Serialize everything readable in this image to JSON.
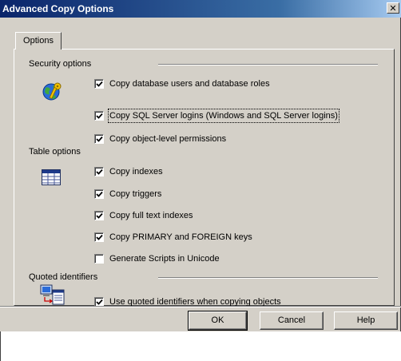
{
  "window": {
    "title": "Advanced Copy Options",
    "close_glyph": "✕"
  },
  "tabs": [
    {
      "label": "Options"
    }
  ],
  "sections": {
    "security": {
      "label": "Security options",
      "icon": "security-globe-key-icon",
      "options": [
        {
          "label": "Copy database users and database roles",
          "checked": true
        },
        {
          "label": "Copy SQL Server logins (Windows and SQL Server logins)",
          "checked": true,
          "focused": true
        },
        {
          "label": "Copy object-level permissions",
          "checked": true
        }
      ]
    },
    "table": {
      "label": "Table options",
      "icon": "table-grid-icon",
      "options": [
        {
          "label": "Copy indexes",
          "checked": true
        },
        {
          "label": "Copy triggers",
          "checked": true
        },
        {
          "label": "Copy full text indexes",
          "checked": true
        },
        {
          "label": "Copy PRIMARY and FOREIGN keys",
          "checked": true
        },
        {
          "label": "Generate Scripts in Unicode",
          "checked": false
        }
      ]
    },
    "quoted": {
      "label": "Quoted identifiers",
      "icon": "quoted-identifiers-icon",
      "options": [
        {
          "label": "Use quoted identifiers when copying objects",
          "checked": true
        }
      ]
    }
  },
  "buttons": {
    "ok": "OK",
    "cancel": "Cancel",
    "help": "Help"
  }
}
